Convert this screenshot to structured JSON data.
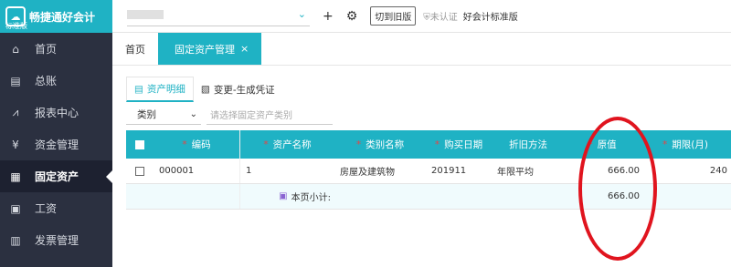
{
  "app": {
    "name": "畅捷通好会计",
    "edition": "标准版"
  },
  "sidebar": {
    "items": [
      {
        "label": "首页",
        "icon": "home-icon"
      },
      {
        "label": "总账",
        "icon": "ledger-icon"
      },
      {
        "label": "报表中心",
        "icon": "chart-icon"
      },
      {
        "label": "资金管理",
        "icon": "money-icon"
      },
      {
        "label": "固定资产",
        "icon": "building-icon",
        "active": true
      },
      {
        "label": "工资",
        "icon": "salary-icon"
      },
      {
        "label": "发票管理",
        "icon": "invoice-icon"
      }
    ]
  },
  "topbar": {
    "switch_label": "切到旧版",
    "unverified_label": "未认证",
    "standard_label": "好会计标准版"
  },
  "tabs": [
    {
      "label": "首页"
    },
    {
      "label": "固定资产管理",
      "active": true,
      "close": "×"
    }
  ],
  "subtabs": [
    {
      "label": "资产明细",
      "active": true
    },
    {
      "label": "变更-生成凭证"
    }
  ],
  "filter": {
    "category_label": "类别",
    "placeholder": "请选择固定资产类别"
  },
  "table": {
    "headers": [
      "编码",
      "资产名称",
      "类别名称",
      "购买日期",
      "折旧方法",
      "原值",
      "期限(月)"
    ],
    "rows": [
      {
        "code": "000001",
        "name": "1",
        "category": "房屋及建筑物",
        "date": "201911",
        "method": "年限平均",
        "value": "666.00",
        "term": "240"
      }
    ],
    "subtotal_label": "本页小计:",
    "subtotal_value": "666.00"
  },
  "colors": {
    "accent": "#1fb2c4",
    "sidebar": "#2b3040",
    "annotation": "#e0141e"
  }
}
